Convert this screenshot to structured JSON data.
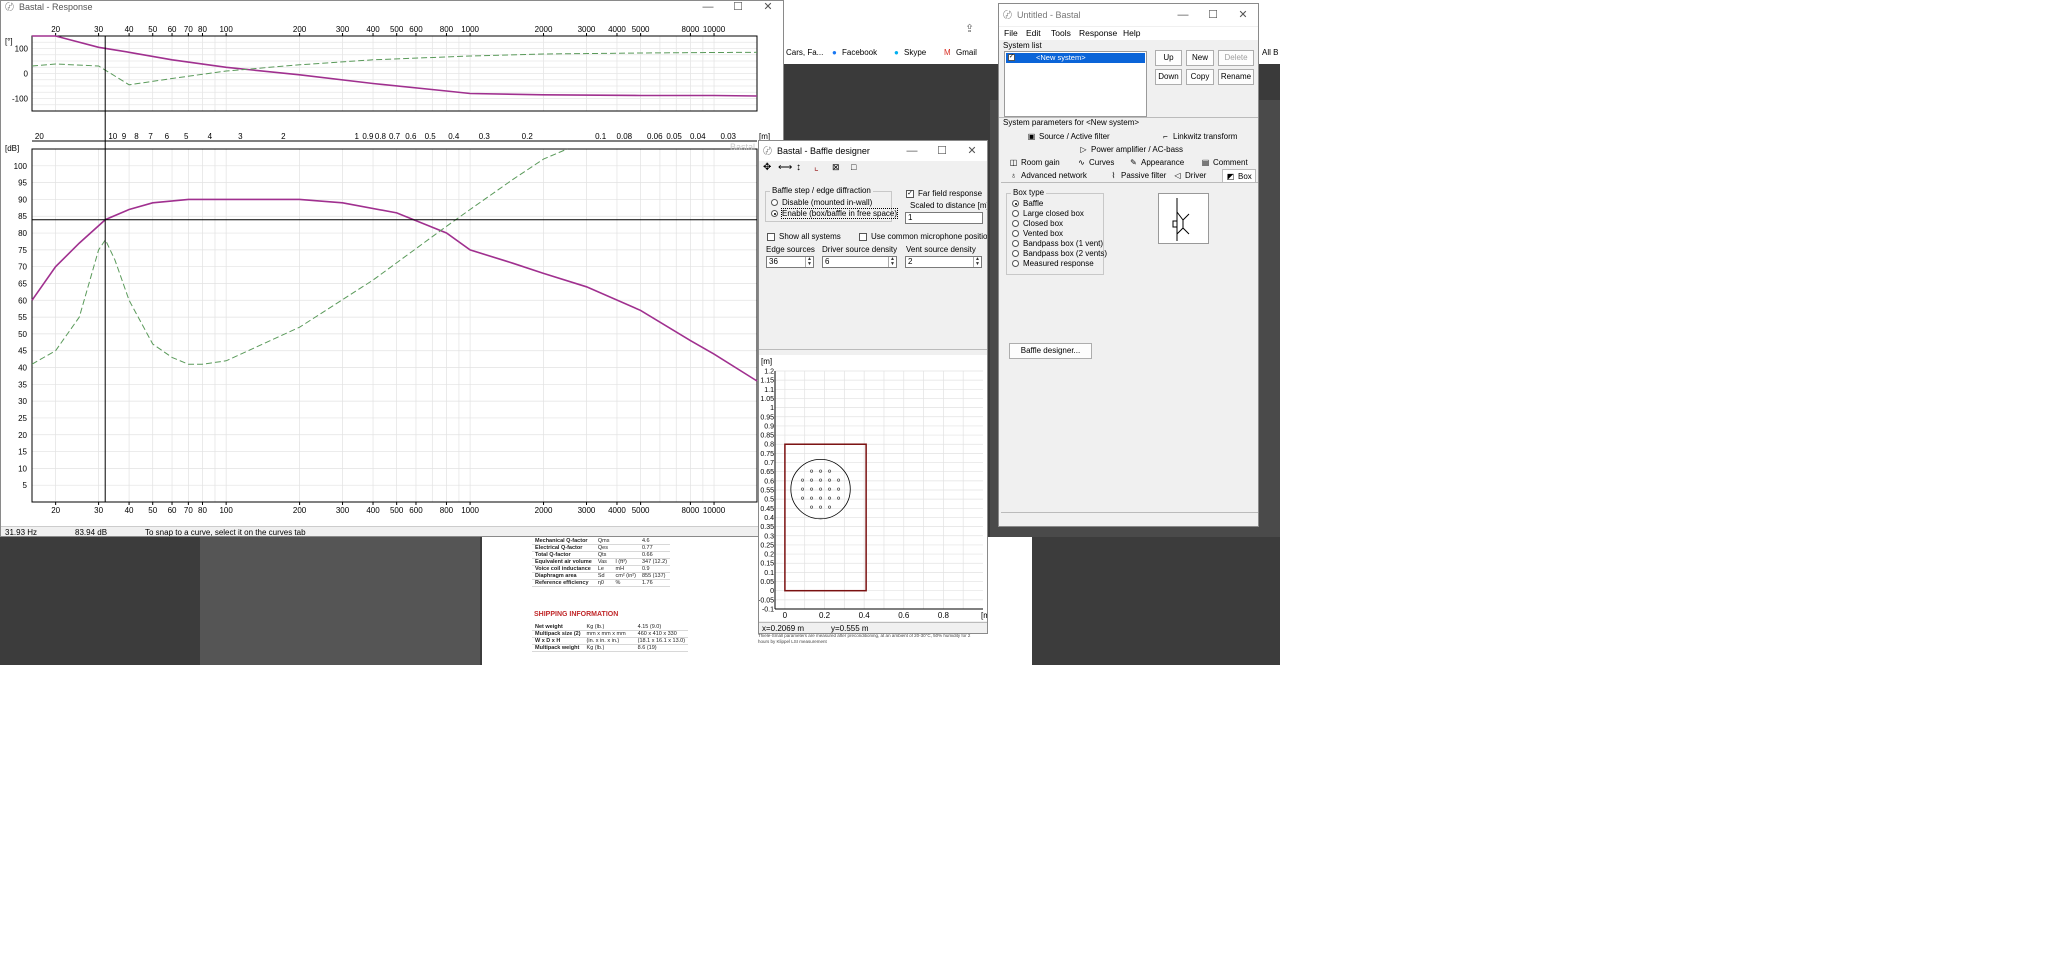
{
  "response_window": {
    "title": "Bastal - Response",
    "phase_ylabel": "[°]",
    "phase_yticks": [
      "100",
      "0",
      "-100"
    ],
    "freq_top_labels": [
      "20",
      "30",
      "40",
      "50",
      "60",
      "70",
      "80",
      "100",
      "200",
      "300",
      "400",
      "500",
      "600",
      "800",
      "1000",
      "2000",
      "3000",
      "4000",
      "5000",
      "8000",
      "10000"
    ],
    "wavelength_labels": [
      "30",
      "20",
      "10",
      "9",
      "8",
      "7",
      "6",
      "5",
      "4",
      "3",
      "2",
      "1",
      "0.9",
      "0.8",
      "0.7",
      "0.6",
      "0.5",
      "0.4",
      "0.3",
      "0.2",
      "0.1",
      "0.08",
      "0.06",
      "0.05",
      "0.04",
      "0.03"
    ],
    "wavelength_unit": "[m]",
    "spl_ylabel": "[dB]",
    "spl_yticks": [
      "100",
      "95",
      "90",
      "85",
      "80",
      "75",
      "70",
      "65",
      "60",
      "55",
      "50",
      "45",
      "40",
      "35",
      "30",
      "25",
      "20",
      "15",
      "10",
      "5"
    ],
    "freq_bottom_labels": [
      "20",
      "30",
      "40",
      "50",
      "60",
      "70",
      "80",
      "100",
      "200",
      "300",
      "400",
      "500",
      "600",
      "800",
      "1000",
      "2000",
      "3000",
      "4000",
      "5000",
      "8000",
      "10000"
    ],
    "freq_unit": "Hz",
    "watermark": "Bastal",
    "status_freq": "31.93 Hz",
    "status_db": "83.94 dB",
    "status_hint": "To snap to a curve, select it on the curves tab"
  },
  "chart_data": [
    {
      "type": "line",
      "title": "",
      "xlabel": "Hz",
      "ylabel": "[°]",
      "xscale": "log",
      "xlim": [
        16,
        15000
      ],
      "ylim": [
        -150,
        150
      ],
      "series": [
        {
          "color": "#a0308f",
          "style": "solid",
          "x": [
            16,
            20,
            30,
            40,
            60,
            100,
            200,
            400,
            800,
            1000,
            2000,
            5000,
            10000,
            15000
          ],
          "y": [
            160,
            150,
            105,
            85,
            55,
            25,
            -5,
            -40,
            -70,
            -80,
            -85,
            -88,
            -88,
            -90
          ]
        },
        {
          "color": "#5a9a5a",
          "style": "dashed",
          "x": [
            16,
            20,
            30,
            40,
            60,
            100,
            200,
            400,
            1000,
            2000,
            5000,
            10000,
            15000
          ],
          "y": [
            30,
            38,
            30,
            -45,
            -20,
            10,
            35,
            55,
            70,
            78,
            82,
            84,
            85
          ]
        }
      ]
    },
    {
      "type": "line",
      "title": "",
      "xlabel": "Hz",
      "ylabel": "[dB]",
      "xscale": "log",
      "xlim": [
        16,
        15000
      ],
      "ylim": [
        0,
        105
      ],
      "series": [
        {
          "color": "#a0308f",
          "style": "solid",
          "x": [
            16,
            20,
            25,
            32,
            40,
            50,
            70,
            100,
            200,
            300,
            500,
            800,
            1000,
            1500,
            2000,
            3000,
            5000,
            8000,
            10000,
            15000
          ],
          "y": [
            60,
            70,
            77,
            84,
            87,
            89,
            90,
            90,
            90,
            89,
            86,
            80,
            75,
            71,
            68,
            64,
            57,
            48,
            44,
            36
          ]
        },
        {
          "color": "#5a9a5a",
          "style": "dashed",
          "x": [
            16,
            20,
            25,
            30,
            32,
            35,
            40,
            50,
            60,
            70,
            80,
            100,
            200,
            400,
            800,
            1000,
            1500,
            2000,
            2500
          ],
          "y": [
            41,
            45,
            55,
            75,
            78,
            72,
            60,
            47,
            43,
            41,
            41,
            42,
            52,
            66,
            82,
            87,
            96,
            102,
            108
          ]
        }
      ]
    }
  ],
  "browser_bg": {
    "bookmarks": [
      "Cars, Fa...",
      "Facebook",
      "Skype",
      "Gmail"
    ],
    "right_label": "All B"
  },
  "datasheet": {
    "rows": [
      [
        "Mechanical Q-factor",
        "Qms",
        "",
        "4.6"
      ],
      [
        "Electrical Q-factor",
        "Qes",
        "",
        "0.77"
      ],
      [
        "Total Q-factor",
        "Qts",
        "",
        "0.66"
      ],
      [
        "Equivalent air volume",
        "Vas",
        "l (ft³)",
        "347 (12.2)"
      ],
      [
        "Voice coil inductance",
        "Le",
        "mH",
        "0.9"
      ],
      [
        "Diaphragm area",
        "Sd",
        "cm² (in²)",
        "855 (137)"
      ],
      [
        "Reference efficiency",
        "η0",
        "%",
        "1.76"
      ]
    ],
    "shipping_heading": "SHIPPING INFORMATION",
    "shipping_rows": [
      [
        "Net weight",
        "Kg (lb.)",
        "",
        "4.15 (9.0)"
      ],
      [
        "Multipack size (2)",
        "mm x mm x mm",
        "",
        "460 x 410 x 330"
      ],
      [
        "W x D x H",
        "(in. x in. x in.)",
        "",
        "(18.1 x 16.1 x 13.0)"
      ],
      [
        "Multipack weight",
        "Kg (lb.)",
        "",
        "8.6 (19)"
      ]
    ],
    "footnote": "Thiele-Small parameters are measured after preconditioning, at an ambient of 20-30°C, 50% humidity for 2 hours by Klippel LSI measurement"
  },
  "baffle_window": {
    "title": "Bastal - Baffle designer",
    "group_title": "Baffle step / edge diffraction",
    "radio_disable": "Disable (mounted in-wall)",
    "radio_enable": "Enable (box/baffle in free space)",
    "far_field_label": "Far field response",
    "scaled_label": "Scaled to distance [m]",
    "scaled_value": "1",
    "show_all_label": "Show all systems",
    "common_mic_label": "Use common microphone position",
    "edge_label": "Edge sources",
    "edge_value": "36",
    "driver_label": "Driver source density",
    "driver_value": "6",
    "vent_label": "Vent source density",
    "vent_value": "2",
    "y_unit": "[m]",
    "y_ticks": [
      "1.2",
      "1.15",
      "1.1",
      "1.05",
      "1",
      "0.95",
      "0.9",
      "0.85",
      "0.8",
      "0.75",
      "0.7",
      "0.65",
      "0.6",
      "0.55",
      "0.5",
      "0.45",
      "0.4",
      "0.35",
      "0.3",
      "0.25",
      "0.2",
      "0.15",
      "0.1",
      "0.05",
      "0",
      "-0.05",
      "-0.1"
    ],
    "x_ticks": [
      "0",
      "0.2",
      "0.4",
      "0.6",
      "0.8"
    ],
    "x_unit": "[m]",
    "status_x": "x=0.2069 m",
    "status_y": "y=0.555 m"
  },
  "main_window": {
    "title": "Untitled - Bastal",
    "menu": [
      "File",
      "Edit",
      "Tools",
      "Response",
      "Help"
    ],
    "system_list_label": "System list",
    "system_item": "<New system>",
    "buttons": {
      "up": "Up",
      "new": "New",
      "delete": "Delete",
      "down": "Down",
      "copy": "Copy",
      "rename": "Rename"
    },
    "params_label": "System parameters for <New system>",
    "tabs_row1": [
      "Source / Active filter",
      "Linkwitz transform"
    ],
    "tabs_row2": [
      "Power amplifier / AC-bass"
    ],
    "tabs_row3": [
      "Room gain",
      "Curves",
      "Appearance",
      "Comment"
    ],
    "tabs_row4": [
      "Advanced network",
      "Passive filter",
      "Driver",
      "Box"
    ],
    "box_type_label": "Box type",
    "box_types": [
      "Baffle",
      "Large closed box",
      "Closed box",
      "Vented box",
      "Bandpass box (1 vent)",
      "Bandpass box (2 vents)",
      "Measured response"
    ],
    "baffle_designer_button": "Baffle designer..."
  }
}
